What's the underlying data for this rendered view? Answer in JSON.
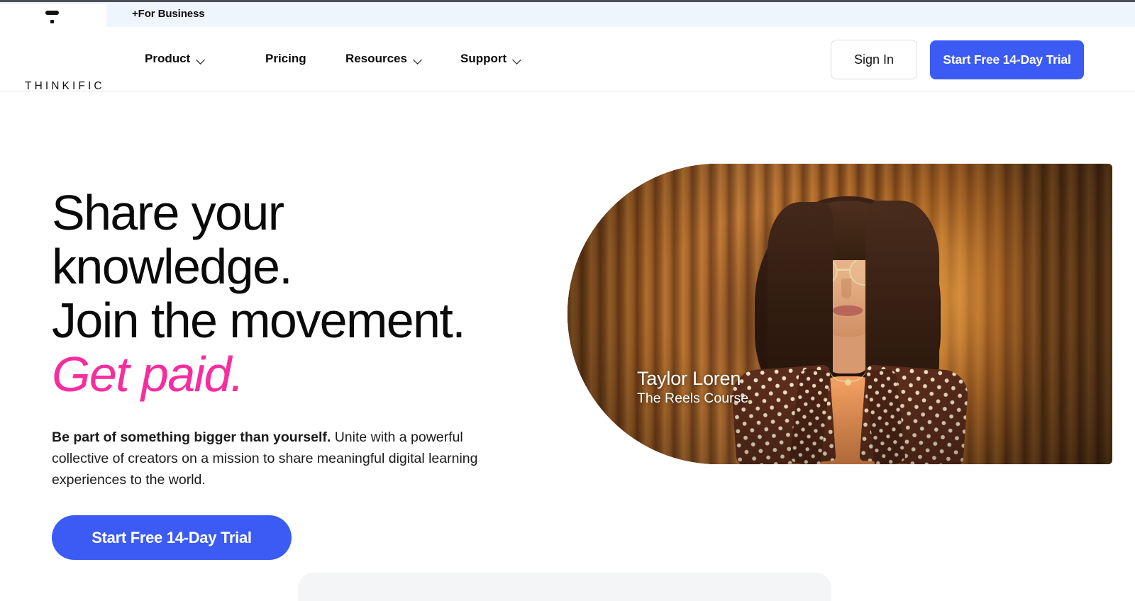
{
  "browser_strip": {
    "tab_logo_icon": "thinkific-mark-icon",
    "tab_title": "+For Business"
  },
  "header": {
    "brand": "THINKIFIC",
    "nav": [
      {
        "label": "Product",
        "has_chevron": true,
        "icon": "chevron-down-icon"
      },
      {
        "label": "Pricing",
        "has_chevron": false,
        "icon": ""
      },
      {
        "label": "Resources",
        "has_chevron": true,
        "icon": "chevron-down-icon"
      },
      {
        "label": "Support",
        "has_chevron": true,
        "icon": "chevron-down-icon"
      }
    ],
    "sign_in_label": "Sign In",
    "trial_label": "Start Free 14-Day Trial"
  },
  "hero": {
    "headline_line1": "Share your",
    "headline_line2": "knowledge.",
    "headline_line3": "Join the movement.",
    "headline_accent": "Get paid.",
    "sub_bold": "Be part of something bigger than yourself.",
    "sub_rest": " Unite with a powerful collective of creators on a mission to share meaningful digital learning experiences to the world.",
    "cta_label": "Start Free 14-Day Trial",
    "media": {
      "caption_name": "Taylor Loren",
      "caption_course": "The Reels Course",
      "alt": "Creator with glasses in patterned jacket against warm slatted wood wall"
    }
  },
  "colors": {
    "brand_blue": "#3b5bf4",
    "accent_pink": "#f72d9f",
    "strip_blue": "#eef5fd",
    "text_black": "#0a0a0a",
    "header_border": "#e8e8ea"
  }
}
